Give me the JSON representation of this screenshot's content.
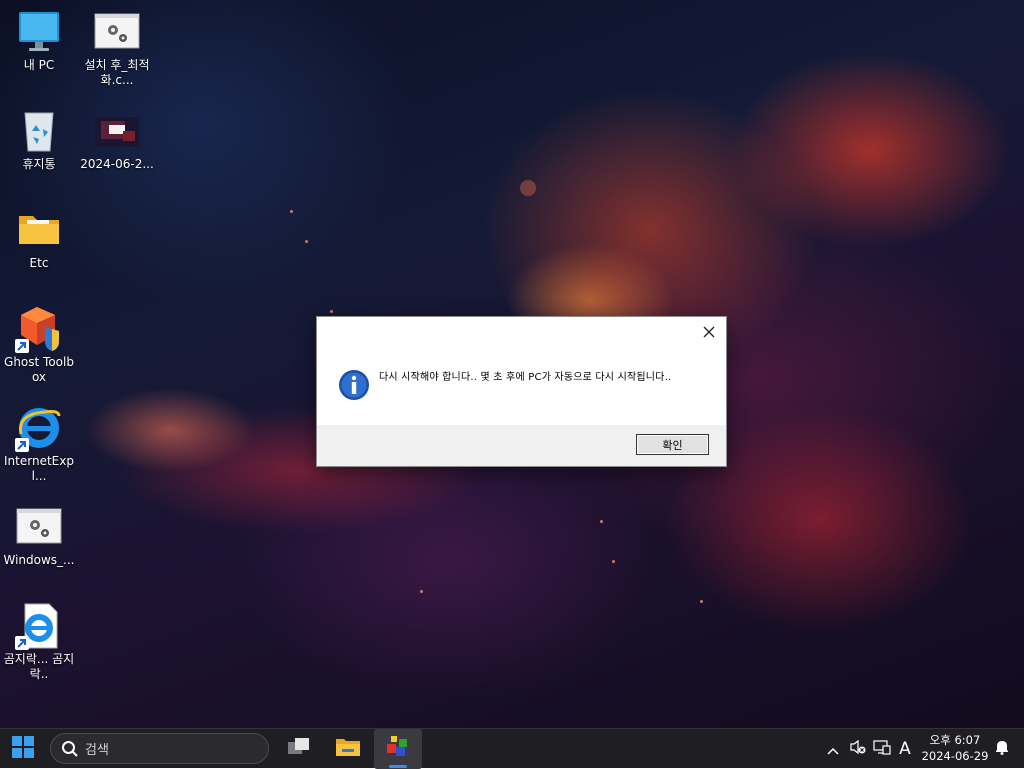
{
  "desktop": {
    "icons": [
      {
        "label": "내 PC",
        "icon": "computer-icon"
      },
      {
        "label": "설치 후_최적화.c...",
        "icon": "settings-file-icon"
      },
      {
        "label": "휴지통",
        "icon": "recycle-bin-icon"
      },
      {
        "label": "2024-06-2...",
        "icon": "screenshot-file-icon"
      },
      {
        "label": "Etc",
        "icon": "folder-icon"
      },
      {
        "label": "Ghost Toolbox",
        "icon": "ghost-toolbox-icon"
      },
      {
        "label": "InternetExpl...",
        "icon": "internet-explorer-icon"
      },
      {
        "label": "Windows_...",
        "icon": "settings-file-icon"
      },
      {
        "label": "곰지락... 곰지락..",
        "icon": "internet-explorer-file-icon"
      }
    ]
  },
  "dialog": {
    "message": "다시 시작해야 합니다.. 몇 초 후에 PC가 자동으로 다시 시작됩니다..",
    "ok_label": "확인",
    "close_icon": "close-icon",
    "info_icon": "information-icon"
  },
  "taskbar": {
    "search_placeholder": "검색",
    "clock_time": "오후 6:07",
    "clock_date": "2024-06-29",
    "ime_label": "A"
  },
  "colors": {
    "taskbar_bg": "#1f1f23",
    "dialog_footer": "#f0f0f0",
    "accent_blue": "#3a8ee6"
  }
}
